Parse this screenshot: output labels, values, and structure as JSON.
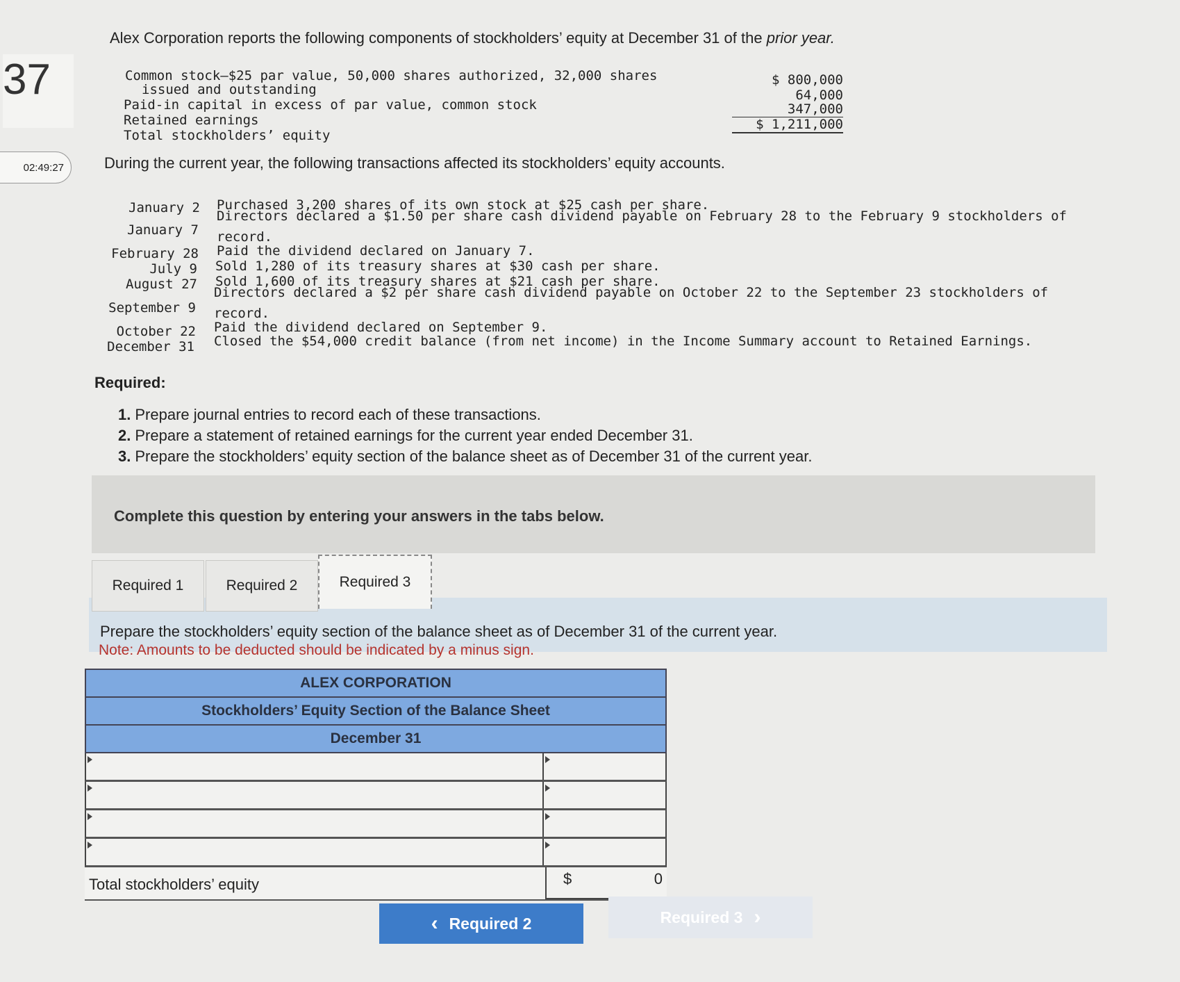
{
  "question": {
    "number": "37",
    "timer": "02:49:27",
    "intro_prefix": "Alex Corporation reports the following components of stockholders’ equity at December 31 of the ",
    "intro_italic": "prior year.",
    "equity_components": [
      {
        "label_line1": "Common stock—$25 par value, 50,000 shares authorized, 32,000 shares",
        "label_line2": "issued and outstanding",
        "amount": "$ 800,000"
      },
      {
        "label_line1": "Paid-in capital in excess of par value, common stock",
        "amount": "64,000"
      },
      {
        "label_line1": "Retained earnings",
        "amount": "347,000"
      },
      {
        "label_line1": "Total stockholders’ equity",
        "amount": "$ 1,211,000"
      }
    ],
    "during_text": "During the current year, the following transactions affected its stockholders’ equity accounts.",
    "transactions": [
      {
        "date": "January 2",
        "desc": "Purchased 3,200 shares of its own stock at $25 cash per share."
      },
      {
        "date": "January 7",
        "desc": "Directors declared a $1.50 per share cash dividend payable on February 28 to the February 9 stockholders of",
        "desc2": "record."
      },
      {
        "date": "February 28",
        "desc": "Paid the dividend declared on January 7."
      },
      {
        "date": "July 9",
        "desc": "Sold 1,280 of its treasury shares at $30 cash per share."
      },
      {
        "date": "August 27",
        "desc": "Sold 1,600 of its treasury shares at $21 cash per share."
      },
      {
        "date": "September 9",
        "desc": "Directors declared a $2 per share cash dividend payable on October 22 to the September 23 stockholders of",
        "desc2": "record."
      },
      {
        "date": "October 22",
        "desc": "Paid the dividend declared on September 9."
      },
      {
        "date": "December 31",
        "desc": "Closed the $54,000 credit balance (from net income) in the Income Summary account to Retained Earnings."
      }
    ],
    "required_heading": "Required:",
    "required_items": [
      {
        "num": "1.",
        "text": "Prepare journal entries to record each of these transactions."
      },
      {
        "num": "2.",
        "text": "Prepare a statement of retained earnings for the current year ended December 31."
      },
      {
        "num": "3.",
        "text": "Prepare the stockholders’ equity section of the balance sheet as of December 31 of the current year."
      }
    ]
  },
  "complete_text": "Complete this question by entering your answers in the tabs below.",
  "tabs": [
    {
      "label": "Required 1",
      "active": false
    },
    {
      "label": "Required 2",
      "active": false
    },
    {
      "label": "Required 3",
      "active": true
    }
  ],
  "instructions": {
    "line1": "Prepare the stockholders’ equity section of the balance sheet as of December 31 of the current year.",
    "note": "Note: Amounts to be deducted should be indicated by a minus sign."
  },
  "balance_sheet": {
    "company": "ALEX CORPORATION",
    "title": "Stockholders’ Equity Section of the Balance Sheet",
    "date": "December 31",
    "rows": [
      {
        "label": "",
        "amount": ""
      },
      {
        "label": "",
        "amount": ""
      },
      {
        "label": "",
        "amount": ""
      },
      {
        "label": "",
        "amount": ""
      }
    ],
    "total_label": "Total stockholders’ equity",
    "total_currency": "$",
    "total_value": "0"
  },
  "nav": {
    "prev_label": "Required 2",
    "next_label": "Required 3",
    "prev_icon": "‹",
    "next_icon": "›"
  }
}
